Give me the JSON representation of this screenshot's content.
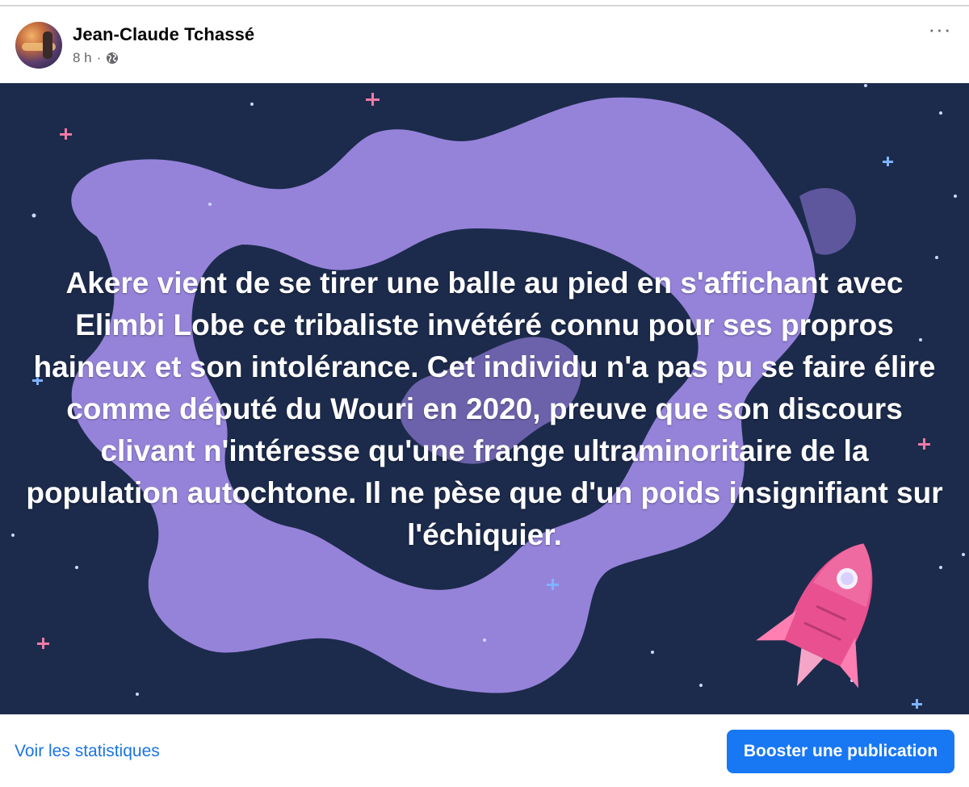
{
  "post": {
    "author": "Jean-Claude Tchassé",
    "time": "8 h",
    "separator": "·",
    "privacy_icon": "globe-icon",
    "more_label": "···",
    "text": "Akere vient de se tirer une balle au pied en s'affichant avec Elimbi Lobe ce tribaliste invétéré connu pour ses propros haineux et son intolérance. Cet individu n'a pas pu se faire élire comme député du Wouri en 2020, preuve que son discours clivant n'intéresse qu'une frange ultraminoritaire de la population autochtone. Il ne pèse que d'un poids insignifiant sur l'échiquier.",
    "background_theme": "space-rocket"
  },
  "footer": {
    "stats_label": "Voir les statistiques",
    "boost_label": "Booster une publication"
  },
  "colors": {
    "background_navy": "#1c2a4b",
    "ribbon_purple": "#9c88e0",
    "accent_blue": "#1877f2",
    "link_blue": "#1b74e4",
    "rocket_pink": "#e8508f"
  }
}
